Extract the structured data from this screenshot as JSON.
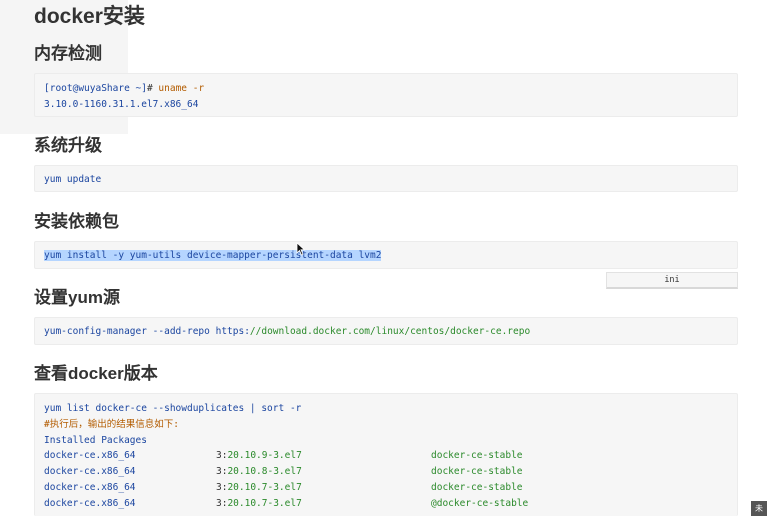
{
  "title": "docker安装",
  "sections": {
    "memory": {
      "heading": "内存检测",
      "prompt": "[root@wuyaShare ~]",
      "hash": "# ",
      "cmd": "uname -r",
      "output": "3.10.0-1160.31.1.el7.x86_64"
    },
    "upgrade": {
      "heading": "系统升级",
      "code": "yum update"
    },
    "deps": {
      "heading": "安装依赖包",
      "code": "yum install -y yum-utils device-mapper-persistent-data lvm2",
      "lang_tag": "ini"
    },
    "repo": {
      "heading": "设置yum源",
      "cmd": "yum-config-manager --add-repo ",
      "url_scheme": "https:",
      "url_rest": "//download.docker.com/linux/centos/docker-ce.repo"
    },
    "versions": {
      "heading": "查看docker版本",
      "cmd": "yum list docker-ce --showduplicates | sort -r",
      "comment": "#执行后，输出的结果信息如下:",
      "installed": "Installed Packages",
      "rows": [
        {
          "pkg": "docker-ce.x86_64",
          "epoch": "3:",
          "ver": "20.10.9-3.el7",
          "repo": "docker-ce-stable"
        },
        {
          "pkg": "docker-ce.x86_64",
          "epoch": "3:",
          "ver": "20.10.8-3.el7",
          "repo": "docker-ce-stable"
        },
        {
          "pkg": "docker-ce.x86_64",
          "epoch": "3:",
          "ver": "20.10.7-3.el7",
          "repo": "docker-ce-stable"
        },
        {
          "pkg": "docker-ce.x86_64",
          "epoch": "3:",
          "ver": "20.10.7-3.el7",
          "repo": "@docker-ce-stable"
        }
      ]
    }
  },
  "corner_tip": "未",
  "colors": {
    "keyword": "#1c46a0",
    "string": "#2b8a2b",
    "comment": "#b35c00",
    "selection": "#b5d5ff"
  }
}
